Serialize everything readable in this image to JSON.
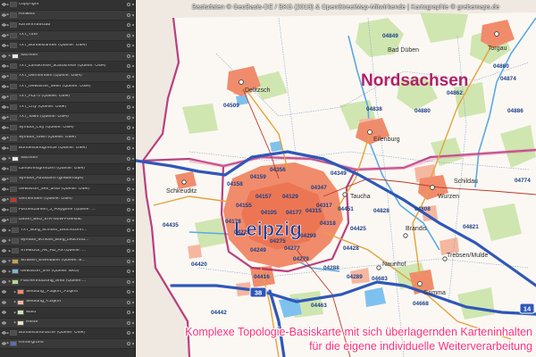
{
  "layers": [
    {
      "name": "Copyright",
      "level": 0,
      "swatch": "#4d4d4d"
    },
    {
      "name": "Hinweis",
      "level": 0,
      "swatch": "#4d4d4d"
    },
    {
      "name": "Kartenmaßstab",
      "level": 0,
      "swatch": "#4d4d4d"
    },
    {
      "name": "TXT_Titel",
      "level": 0,
      "swatch": "#4d4d4d"
    },
    {
      "name": "TXT_Bundesländer (Quelle: OSM)",
      "level": 0,
      "swatch": "#4d4d4d"
    },
    {
      "name": "Sachsen",
      "level": 1,
      "swatch": "#e8e8e8"
    },
    {
      "name": "TXT_Landkreise_Stadtkreise (Quelle: OSM)",
      "level": 0,
      "swatch": "#4d4d4d"
    },
    {
      "name": "TXT_Gemeinden (Quelle: OSM)",
      "level": 0,
      "swatch": "#4d4d4d"
    },
    {
      "name": "TXT_Gewässer_Seen (Quelle: OSM)",
      "level": 0,
      "swatch": "#4d4d4d"
    },
    {
      "name": "TXT_PLZ-5 (Quelle: OSM)",
      "level": 0,
      "swatch": "#4d4d4d"
    },
    {
      "name": "TXT_City (Quelle: OSM)",
      "level": 0,
      "swatch": "#4d4d4d"
    },
    {
      "name": "TXT_Town (Quelle: OSM)",
      "level": 0,
      "swatch": "#4d4d4d"
    },
    {
      "name": "Symbol_City (Quelle: OSM)",
      "level": 0,
      "swatch": "#4d4d4d"
    },
    {
      "name": "Symbol_Town (Quelle: OSM)",
      "level": 0,
      "swatch": "#4d4d4d"
    },
    {
      "name": "Bundeslandgrenze (Quelle: OSM)",
      "level": 0,
      "swatch": "#4d4d4d"
    },
    {
      "name": "Sachsen",
      "level": 1,
      "swatch": "#e8e8e8"
    },
    {
      "name": "Landkreisgrenzen (Quelle: OSM)",
      "level": 0,
      "swatch": "#4d4d4d"
    },
    {
      "name": "Symbol_Autobahn (grebemaps)",
      "level": 0,
      "swatch": "#4d4d4d"
    },
    {
      "name": "Gewässer_See_area (Quelle: OSM)",
      "level": 0,
      "swatch": "#4d4d4d"
    },
    {
      "name": "Gemeinden (Quelle: OSM)",
      "level": 0,
      "swatch": "#c0392b"
    },
    {
      "name": "Postleitzahlen_5_Polygone (Quelle: ...",
      "level": 0,
      "swatch": "#4d4d4d"
    },
    {
      "name": "Daten_BKG_STR-GEW-FUN-BSL",
      "level": 0,
      "swatch": "#4d4d4d"
    },
    {
      "name": "TXT_Burg_Schloss_Leuchtturm...",
      "level": 1,
      "swatch": "#4d4d4d"
    },
    {
      "name": "Symbol_Schloss_Burg_Leuchttu...",
      "level": 1,
      "swatch": "#4d4d4d"
    },
    {
      "name": "SYMBOLE_AK_AD_AS (Quelle: ...",
      "level": 1,
      "swatch": "#4d4d4d"
    },
    {
      "name": "Straßen_Eisenbahn (Quelle: B...",
      "level": 1,
      "swatch": "#c9a14a"
    },
    {
      "name": "Gewässer_line (Quelle: BKG)",
      "level": 1,
      "swatch": "#7fb3d5"
    },
    {
      "name": "Flächennutzung_area (Quelle:...",
      "level": 1,
      "swatch": "#b8d98a"
    },
    {
      "name": "Siedlung_>5qkm_>2qkm",
      "level": 2,
      "swatch": "#f08c6c"
    },
    {
      "name": "Siedlung_<2qkm",
      "level": 2,
      "swatch": "#f5b7a0"
    },
    {
      "name": "Wald",
      "level": 2,
      "swatch": "#cfe6b0"
    },
    {
      "name": "Heide",
      "level": 2,
      "swatch": "#e9e2c4"
    },
    {
      "name": "Bundeslandfläche (Quelle: OSM)",
      "level": 0,
      "swatch": "#4d4d4d"
    },
    {
      "name": "Hintergrund",
      "level": 0,
      "swatch": "#5a6fb0"
    }
  ],
  "map": {
    "attribution": "Basisdaten © GeoBasis-DE / BKG (2019) & OpenStreetMap-Mitwirkende  |  Kartographie © grebemaps.de",
    "district_label": "Nordsachsen",
    "city_label": "Leipzig",
    "slogan_line1": "Komplexe Topologie-Basiskarte mit sich überlagernden Karteninhalten",
    "slogan_line2": "für die eigene individuelle Weiterverarbeitung",
    "road_shields": [
      {
        "id": "a38",
        "text": "38"
      },
      {
        "id": "a14",
        "text": "14"
      }
    ],
    "towns": [
      {
        "id": "delitzsch",
        "name": "Delitzsch"
      },
      {
        "id": "eilenburg",
        "name": "Eilenburg"
      },
      {
        "id": "torgau",
        "name": "Torgau"
      },
      {
        "id": "bad-dueben",
        "name": "Bad Düben"
      },
      {
        "id": "schildau",
        "name": "Schildau"
      },
      {
        "id": "wurzen",
        "name": "Wurzen"
      },
      {
        "id": "taucha",
        "name": "Taucha"
      },
      {
        "id": "grimma",
        "name": "Grimma"
      },
      {
        "id": "naunhof",
        "name": "Naunhof"
      },
      {
        "id": "brandis",
        "name": "Brandis"
      },
      {
        "id": "trebsen",
        "name": "Trebsen/Mulde"
      },
      {
        "id": "schkeuditz",
        "name": "Schkeuditz"
      }
    ],
    "postcodes": [
      {
        "id": "p04860",
        "text": "04860"
      },
      {
        "id": "p04862",
        "text": "04862"
      },
      {
        "id": "p04886",
        "text": "04886"
      },
      {
        "id": "p04874",
        "text": "04874"
      },
      {
        "id": "p04880",
        "text": "04880"
      },
      {
        "id": "p04838",
        "text": "04838"
      },
      {
        "id": "p04849",
        "text": "04849"
      },
      {
        "id": "p04509",
        "text": "04509"
      },
      {
        "id": "p04356",
        "text": "04356"
      },
      {
        "id": "p04158",
        "text": "04158"
      },
      {
        "id": "p04159",
        "text": "04159"
      },
      {
        "id": "p04157",
        "text": "04157"
      },
      {
        "id": "p04129",
        "text": "04129"
      },
      {
        "id": "p04155",
        "text": "04155"
      },
      {
        "id": "p04105",
        "text": "04105"
      },
      {
        "id": "p04347",
        "text": "04347"
      },
      {
        "id": "p04349",
        "text": "04349"
      },
      {
        "id": "p04177",
        "text": "04177"
      },
      {
        "id": "p04315",
        "text": "04315"
      },
      {
        "id": "p04318",
        "text": "04318"
      },
      {
        "id": "p04299",
        "text": "04299"
      },
      {
        "id": "p04317",
        "text": "04317"
      },
      {
        "id": "p04275",
        "text": "04275"
      },
      {
        "id": "p04277",
        "text": "04277"
      },
      {
        "id": "p04279",
        "text": "04279"
      },
      {
        "id": "p04249",
        "text": "04249"
      },
      {
        "id": "p04229",
        "text": "04229"
      },
      {
        "id": "p04178",
        "text": "04178"
      },
      {
        "id": "p04416",
        "text": "04416"
      },
      {
        "id": "p04420",
        "text": "04420"
      },
      {
        "id": "p04435",
        "text": "04435"
      },
      {
        "id": "p04442",
        "text": "04442"
      },
      {
        "id": "p04463",
        "text": "04463"
      },
      {
        "id": "p04668",
        "text": "04668"
      },
      {
        "id": "p04683",
        "text": "04683"
      },
      {
        "id": "p04808",
        "text": "04808"
      },
      {
        "id": "p04828",
        "text": "04828"
      },
      {
        "id": "p04821",
        "text": "04821"
      },
      {
        "id": "p04774",
        "text": "04774"
      },
      {
        "id": "p04451",
        "text": "04451"
      },
      {
        "id": "p04425",
        "text": "04425"
      },
      {
        "id": "p04428",
        "text": "04428"
      },
      {
        "id": "p04288",
        "text": "04288"
      },
      {
        "id": "p04289",
        "text": "04289"
      }
    ]
  },
  "colors": {
    "panel_bg": "#323232",
    "settlement": "#f08c6c",
    "settlement_core": "#e9643f",
    "forest": "#cfe6b0",
    "water": "#5aa9e6",
    "district_border": "#b0206a",
    "slogan": "#ff2f77",
    "highway": "#2f57b8"
  }
}
